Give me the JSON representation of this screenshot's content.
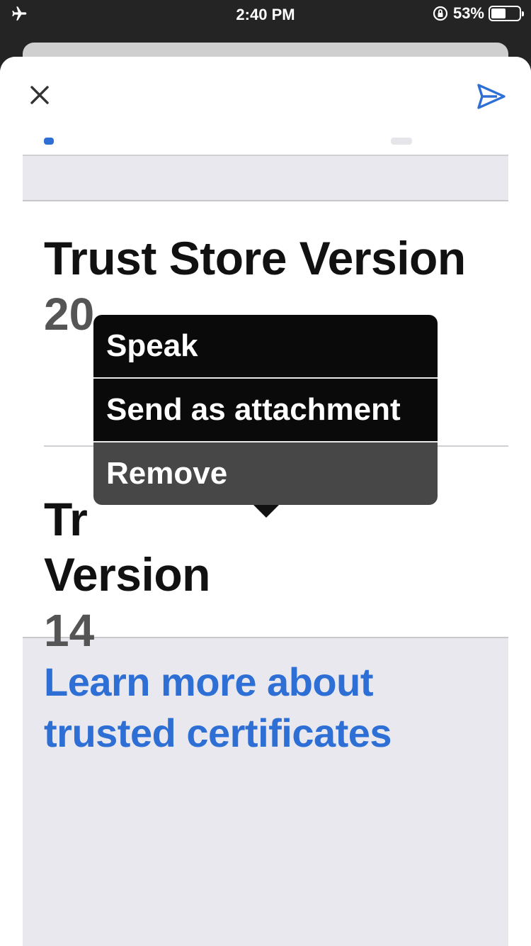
{
  "status_bar": {
    "time": "2:40 PM",
    "battery_text": "53%",
    "battery_level": 0.53,
    "icons": [
      "airplane-icon",
      "rotation-lock-icon",
      "battery-icon"
    ]
  },
  "sheet": {
    "close_icon": "close-icon",
    "send_icon": "send-icon",
    "accent_color": "#2e6fd6"
  },
  "screenshot": {
    "row1": {
      "title": "Trust Store Version",
      "value": "20"
    },
    "row2": {
      "title_line1": "Tr",
      "title_line2": "Version",
      "value": "14"
    },
    "learn_more_line1": "Learn more about",
    "learn_more_line2": "trusted certificates"
  },
  "context_menu": {
    "items": [
      "Speak",
      "Send as attachment",
      "Remove"
    ]
  }
}
